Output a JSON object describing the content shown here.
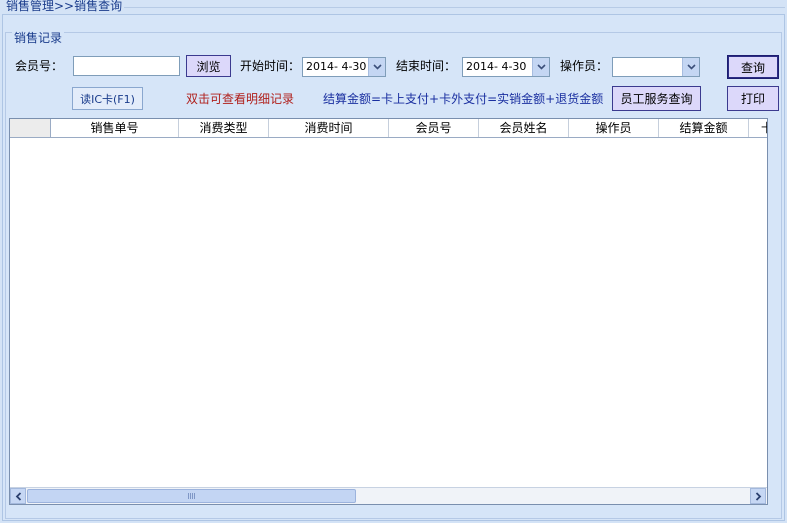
{
  "breadcrumb": "销售管理>>销售查询",
  "group_title": "销售记录",
  "filters": {
    "member_label": "会员号：",
    "member_value": "",
    "browse_label": "浏览",
    "start_label": "开始时间：",
    "start_value": "2014- 4-30",
    "end_label": "结束时间：",
    "end_value": "2014- 4-30",
    "operator_label": "操作员：",
    "operator_value": "",
    "query_label": "查询"
  },
  "actions": {
    "read_card_label": "读IC卡(F1)",
    "hint_double_click": "双击可查看明细记录",
    "hint_formula": "结算金额=卡上支付+卡外支付=实销金额+退货金额",
    "staff_query_label": "员工服务查询",
    "print_label": "打印"
  },
  "table": {
    "columns": [
      "销售单号",
      "消费类型",
      "消费时间",
      "会员号",
      "会员姓名",
      "操作员",
      "结算金额",
      "卡"
    ],
    "rows": []
  }
}
